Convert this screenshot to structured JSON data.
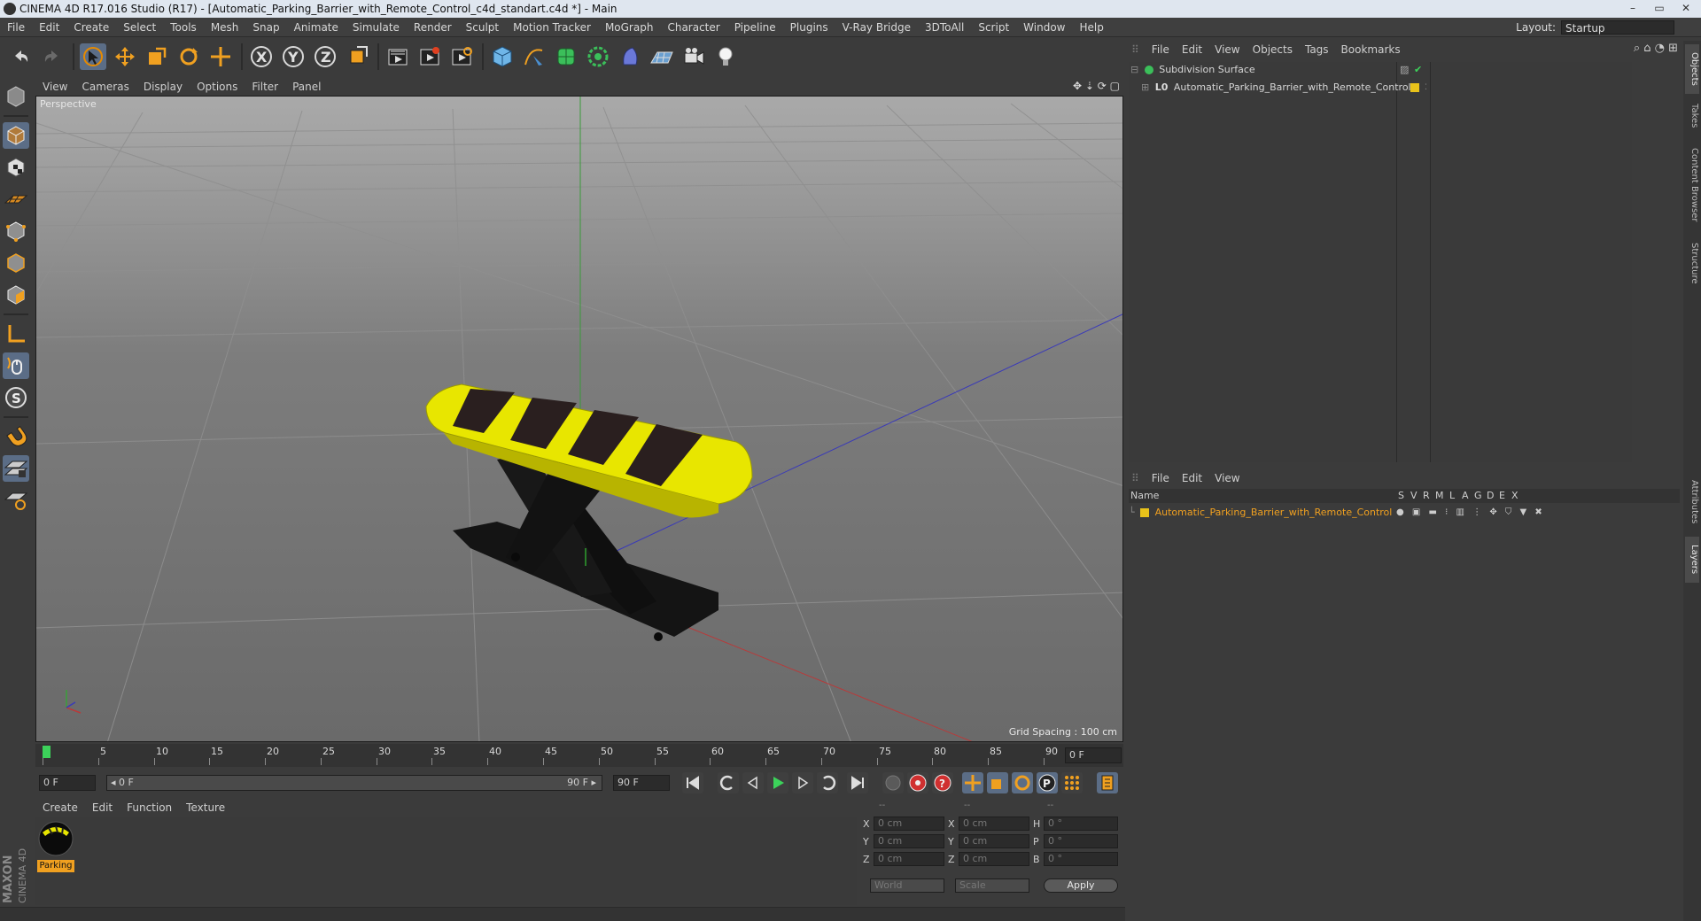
{
  "window": {
    "title": "CINEMA 4D R17.016 Studio (R17) - [Automatic_Parking_Barrier_with_Remote_Control_c4d_standart.c4d *] - Main",
    "controls": [
      "–",
      "▭",
      "✕"
    ]
  },
  "menubar": {
    "items": [
      "File",
      "Edit",
      "Create",
      "Select",
      "Tools",
      "Mesh",
      "Snap",
      "Animate",
      "Simulate",
      "Render",
      "Sculpt",
      "Motion Tracker",
      "MoGraph",
      "Character",
      "Pipeline",
      "Plugins",
      "V-Ray Bridge",
      "3DToAll",
      "Script",
      "Window",
      "Help"
    ],
    "layout_label": "Layout:",
    "layout_value": "Startup"
  },
  "toolbar": {
    "icons": [
      "undo-icon",
      "redo-icon",
      "live-selection-icon",
      "move-icon",
      "scale-icon",
      "rotate-icon",
      "recent-tool-icon",
      "x-axis-lock-icon",
      "y-axis-lock-icon",
      "z-axis-lock-icon",
      "coordinate-system-icon",
      "render-view-icon",
      "render-picture-viewer-icon",
      "edit-render-settings-icon",
      "cube-icon",
      "spline-pen-icon",
      "subdivision-icon",
      "cloner-icon",
      "deformer-icon",
      "floor-icon",
      "camera-icon",
      "light-icon"
    ],
    "axis_labels": [
      "X",
      "Y",
      "Z"
    ]
  },
  "left_tools": [
    "make-editable-icon",
    "model-mode-icon",
    "texture-mode-icon",
    "workplane-icon",
    "points-mode-icon",
    "edges-mode-icon",
    "polygons-mode-icon",
    "enable-axis-icon",
    "tweak-mode-icon",
    "solo-icon",
    "snap-icon",
    "workplane-lock-icon",
    "workplane-snap-icon"
  ],
  "viewport": {
    "menu": [
      "View",
      "Cameras",
      "Display",
      "Options",
      "Filter",
      "Panel"
    ],
    "label": "Perspective",
    "grid_spacing": "Grid Spacing : 100 cm"
  },
  "timeline": {
    "ticks": [
      "0",
      "5",
      "10",
      "15",
      "20",
      "25",
      "30",
      "35",
      "40",
      "45",
      "50",
      "55",
      "60",
      "65",
      "70",
      "75",
      "80",
      "85",
      "90"
    ],
    "current_frame": "0 F",
    "start_frame": "0 F",
    "range_start": "◂ 0 F",
    "range_end": "90 F ▸",
    "end_frame": "90 F",
    "playhead": 0
  },
  "material_manager": {
    "menu": [
      "Create",
      "Edit",
      "Function",
      "Texture"
    ],
    "materials": [
      {
        "name": "Parking"
      }
    ]
  },
  "coordinates": {
    "headers": [
      "--",
      "--",
      "--"
    ],
    "rows": [
      {
        "axis": "X",
        "pos": "0 cm",
        "axis2": "X",
        "size": "0 cm",
        "rot_label": "H",
        "rot": "0 °"
      },
      {
        "axis": "Y",
        "pos": "0 cm",
        "axis2": "Y",
        "size": "0 cm",
        "rot_label": "P",
        "rot": "0 °"
      },
      {
        "axis": "Z",
        "pos": "0 cm",
        "axis2": "Z",
        "size": "0 cm",
        "rot_label": "B",
        "rot": "0 °"
      }
    ],
    "mode1": "World",
    "mode2": "Scale",
    "apply": "Apply"
  },
  "object_manager": {
    "menu": [
      "File",
      "Edit",
      "View",
      "Objects",
      "Tags",
      "Bookmarks"
    ],
    "objects": [
      {
        "name": "Subdivision Surface",
        "level": 0
      },
      {
        "name": "Automatic_Parking_Barrier_with_Remote_Control",
        "level": 1
      }
    ]
  },
  "layer_manager": {
    "menu": [
      "File",
      "Edit",
      "View"
    ],
    "columns": [
      "Name",
      "S",
      "V",
      "R",
      "M",
      "L",
      "A",
      "G",
      "D",
      "E",
      "X"
    ],
    "layers": [
      {
        "name": "Automatic_Parking_Barrier_with_Remote_Control",
        "color": "#e8c21a"
      }
    ]
  },
  "side_tabs": [
    "Objects",
    "Takes",
    "Content Browser",
    "Structure",
    "Attributes",
    "Layers"
  ],
  "brand": {
    "maxon": "MAXON",
    "product": "CINEMA 4D"
  },
  "colors": {
    "accent": "#5b6d86",
    "layer_text": "#f0a020",
    "barrier_yellow": "#e8e600",
    "stripe": "#2a1f1f"
  }
}
